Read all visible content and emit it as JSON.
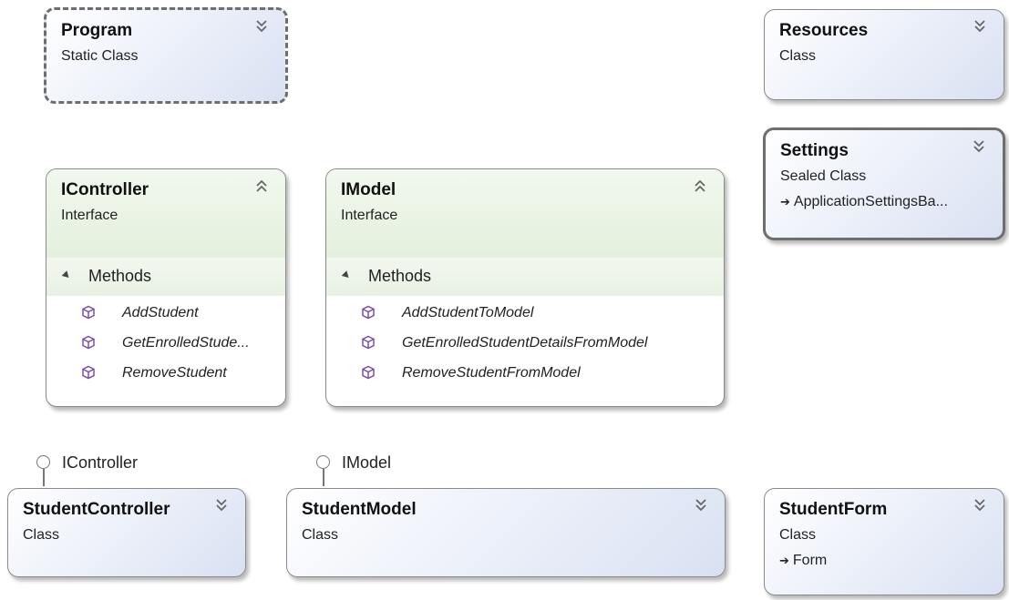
{
  "colors": {
    "class_gradient_end": "#d9e1f2",
    "interface_header": "#e4f0dd",
    "method_icon": "#7b4fb0",
    "border": "#8a8a8a"
  },
  "shapes": {
    "program": {
      "name": "Program",
      "kind": "Static Class",
      "toggle_icon": "double-chevron-down"
    },
    "resources": {
      "name": "Resources",
      "kind": "Class",
      "toggle_icon": "double-chevron-down"
    },
    "settings": {
      "name": "Settings",
      "kind": "Sealed Class",
      "base": "ApplicationSettingsBa...",
      "toggle_icon": "double-chevron-down"
    },
    "icontroller": {
      "name": "IController",
      "kind": "Interface",
      "toggle_icon": "double-chevron-up",
      "section": "Methods",
      "methods": [
        "AddStudent",
        "GetEnrolledStude...",
        "RemoveStudent"
      ]
    },
    "imodel": {
      "name": "IModel",
      "kind": "Interface",
      "toggle_icon": "double-chevron-up",
      "section": "Methods",
      "methods": [
        "AddStudentToModel",
        "GetEnrolledStudentDetailsFromModel",
        "RemoveStudentFromModel"
      ]
    },
    "studentcontroller": {
      "name": "StudentController",
      "kind": "Class",
      "toggle_icon": "double-chevron-down",
      "implements": "IController"
    },
    "studentmodel": {
      "name": "StudentModel",
      "kind": "Class",
      "toggle_icon": "double-chevron-down",
      "implements": "IModel"
    },
    "studentform": {
      "name": "StudentForm",
      "kind": "Class",
      "base": "Form",
      "toggle_icon": "double-chevron-down"
    }
  }
}
